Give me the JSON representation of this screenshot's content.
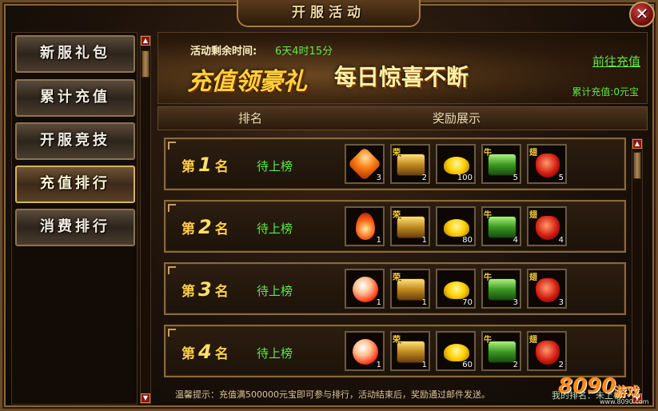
{
  "window": {
    "title": "开服活动",
    "close_label": "✕"
  },
  "sidebar": {
    "items": [
      {
        "label": "新服礼包"
      },
      {
        "label": "累计充值"
      },
      {
        "label": "开服竞技"
      },
      {
        "label": "充值排行",
        "active": true
      },
      {
        "label": "消费排行"
      }
    ]
  },
  "banner": {
    "countdown_label": "活动剩余时间:",
    "countdown_value": "6天4时15分",
    "slogan_main": "充值领豪礼",
    "slogan_sub": "每日惊喜不断",
    "goto_recharge": "前往充值",
    "total_recharge": "累计充值:0元宝"
  },
  "table": {
    "col_rank": "排名",
    "col_reward": "奖励展示"
  },
  "ranks": [
    {
      "prefix": "第",
      "number": "1",
      "suffix": "名",
      "status": "待上榜",
      "items": [
        {
          "icon": "orange-gem-icon",
          "tag": "",
          "count": "3"
        },
        {
          "icon": "gold-chest-icon",
          "tag": "荣",
          "count": "2"
        },
        {
          "icon": "gold-ingot-icon",
          "tag": "",
          "count": "100"
        },
        {
          "icon": "green-chest-icon",
          "tag": "牛",
          "count": "5"
        },
        {
          "icon": "red-pouch-icon",
          "tag": "翅",
          "count": "5"
        }
      ]
    },
    {
      "prefix": "第",
      "number": "2",
      "suffix": "名",
      "status": "待上榜",
      "items": [
        {
          "icon": "fire-gem-icon",
          "tag": "",
          "count": "1"
        },
        {
          "icon": "gold-chest-icon",
          "tag": "荣",
          "count": "1"
        },
        {
          "icon": "gold-ingot-icon",
          "tag": "",
          "count": "80"
        },
        {
          "icon": "green-chest-icon",
          "tag": "牛",
          "count": "4"
        },
        {
          "icon": "red-pouch-icon",
          "tag": "翅",
          "count": "4"
        }
      ]
    },
    {
      "prefix": "第",
      "number": "3",
      "suffix": "名",
      "status": "待上榜",
      "items": [
        {
          "icon": "glow-orb-icon",
          "tag": "",
          "count": "1"
        },
        {
          "icon": "gold-chest-icon",
          "tag": "荣",
          "count": "1"
        },
        {
          "icon": "gold-ingot-icon",
          "tag": "",
          "count": "70"
        },
        {
          "icon": "green-chest-icon",
          "tag": "牛",
          "count": "3"
        },
        {
          "icon": "red-pouch-icon",
          "tag": "翅",
          "count": "3"
        }
      ]
    },
    {
      "prefix": "第",
      "number": "4",
      "suffix": "名",
      "status": "待上榜",
      "items": [
        {
          "icon": "glow-orb-icon",
          "tag": "",
          "count": "1"
        },
        {
          "icon": "gold-chest-icon",
          "tag": "荣",
          "count": "1"
        },
        {
          "icon": "gold-ingot-icon",
          "tag": "",
          "count": "60"
        },
        {
          "icon": "green-chest-icon",
          "tag": "牛",
          "count": "2"
        },
        {
          "icon": "red-pouch-icon",
          "tag": "翅",
          "count": "2"
        }
      ]
    }
  ],
  "hint": "温馨提示：充值满500000元宝即可参与排行，活动结束后，奖励通过邮件发送。",
  "watermark": {
    "number": "8090",
    "game": "游戏",
    "prefix": "我的排名：未上榜",
    "url": "www.8090.com"
  },
  "colors": {
    "accent_green": "#5fe84a",
    "gold": "#ffcf4a",
    "frame": "#8a6634"
  }
}
